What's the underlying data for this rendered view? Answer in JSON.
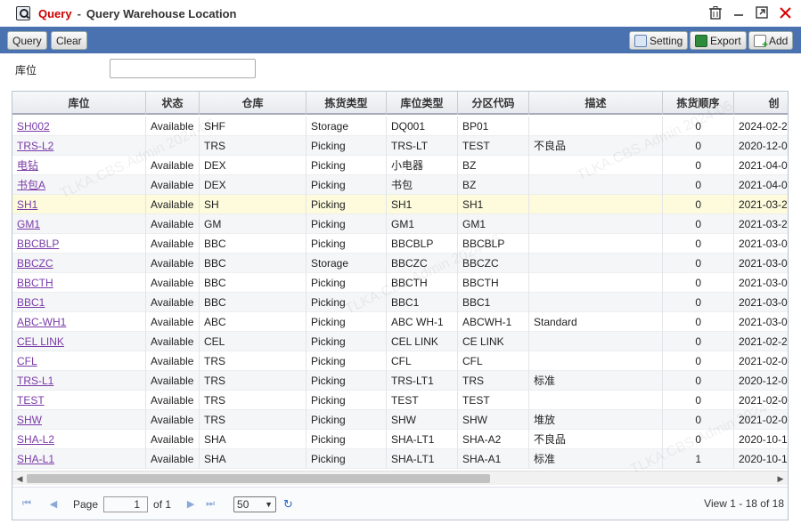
{
  "window": {
    "title": "Query",
    "separator": "-",
    "subtitle": "Query Warehouse Location",
    "controls": [
      "trash-icon",
      "minimize-icon",
      "maximize-icon",
      "close-icon"
    ]
  },
  "toolbar": {
    "query_label": "Query",
    "clear_label": "Clear",
    "setting_label": "Setting",
    "export_label": "Export",
    "add_label": "Add"
  },
  "filter": {
    "label": "库位",
    "value": ""
  },
  "grid": {
    "columns": [
      "库位",
      "状态",
      "仓库",
      "拣货类型",
      "库位类型",
      "分区代码",
      "描述",
      "拣货顺序",
      "创"
    ],
    "rows": [
      [
        "SH002",
        "Available",
        "SHF",
        "Storage",
        "DQ001",
        "BP01",
        "",
        "0",
        "2024-02-2"
      ],
      [
        "TRS-L2",
        "",
        "TRS",
        "Picking",
        "TRS-LT",
        "TEST",
        "不良品",
        "0",
        "2020-12-0"
      ],
      [
        "电钻",
        "Available",
        "DEX",
        "Picking",
        "小电器",
        "BZ",
        "",
        "0",
        "2021-04-0"
      ],
      [
        "书包A",
        "Available",
        "DEX",
        "Picking",
        "书包",
        "BZ",
        "",
        "0",
        "2021-04-0"
      ],
      [
        "SH1",
        "Available",
        "SH",
        "Picking",
        "SH1",
        "SH1",
        "",
        "0",
        "2021-03-2"
      ],
      [
        "GM1",
        "Available",
        "GM",
        "Picking",
        "GM1",
        "GM1",
        "",
        "0",
        "2021-03-2"
      ],
      [
        "BBCBLP",
        "Available",
        "BBC",
        "Picking",
        "BBCBLP",
        "BBCBLP",
        "",
        "0",
        "2021-03-0"
      ],
      [
        "BBCZC",
        "Available",
        "BBC",
        "Storage",
        "BBCZC",
        "BBCZC",
        "",
        "0",
        "2021-03-0"
      ],
      [
        "BBCTH",
        "Available",
        "BBC",
        "Picking",
        "BBCTH",
        "BBCTH",
        "",
        "0",
        "2021-03-0"
      ],
      [
        "BBC1",
        "Available",
        "BBC",
        "Picking",
        "BBC1",
        "BBC1",
        "",
        "0",
        "2021-03-0"
      ],
      [
        "ABC-WH1",
        "Available",
        "ABC",
        "Picking",
        "ABC WH-1",
        "ABCWH-1",
        "Standard",
        "0",
        "2021-03-0"
      ],
      [
        "CEL LINK",
        "Available",
        "CEL",
        "Picking",
        "CEL LINK",
        "CE LINK",
        "",
        "0",
        "2021-02-2"
      ],
      [
        "CFL",
        "Available",
        "TRS",
        "Picking",
        "CFL",
        "CFL",
        "",
        "0",
        "2021-02-0"
      ],
      [
        "TRS-L1",
        "Available",
        "TRS",
        "Picking",
        "TRS-LT1",
        "TRS",
        "标准",
        "0",
        "2020-12-0"
      ],
      [
        "TEST",
        "Available",
        "TRS",
        "Picking",
        "TEST",
        "TEST",
        "",
        "0",
        "2021-02-0"
      ],
      [
        "SHW",
        "Available",
        "TRS",
        "Picking",
        "SHW",
        "SHW",
        "堆放",
        "0",
        "2021-02-0"
      ],
      [
        "SHA-L2",
        "Available",
        "SHA",
        "Picking",
        "SHA-LT1",
        "SHA-A2",
        "不良品",
        "0",
        "2020-10-1"
      ],
      [
        "SHA-L1",
        "Available",
        "SHA",
        "Picking",
        "SHA-LT1",
        "SHA-A1",
        "标准",
        "1",
        "2020-10-1"
      ]
    ],
    "selected_row": 4
  },
  "pager": {
    "page_label": "Page",
    "page_value": "1",
    "of_label": "of 1",
    "rows_per_page": "50",
    "view_info": "View 1 - 18 of 18"
  },
  "watermark": "TLKA.CBS.Admin 2024-06"
}
